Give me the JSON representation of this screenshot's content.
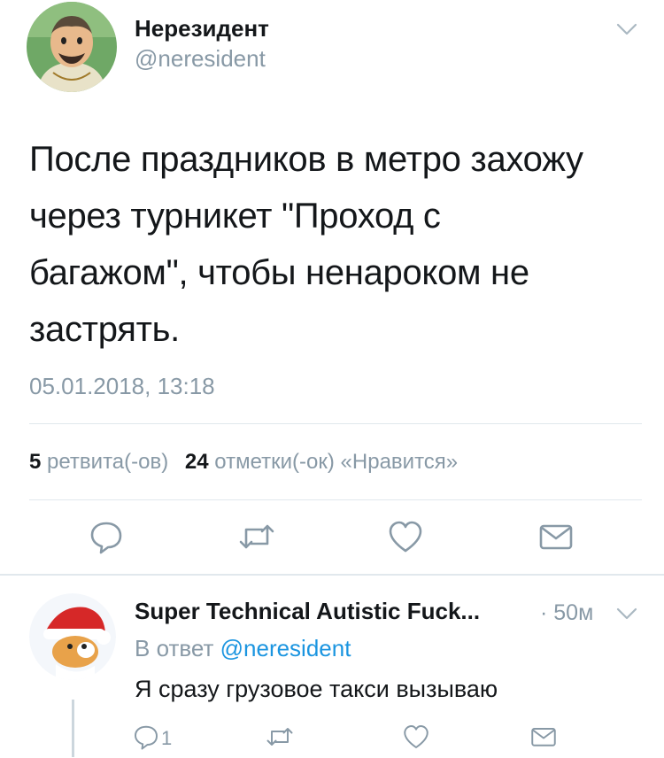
{
  "tweet": {
    "author_name": "Нерезидент",
    "handle": "@neresident",
    "text_lines": [
      "После праздников в метро захожу",
      "через турникет \"Проход с",
      "багажом\", чтобы ненароком не",
      "застрять."
    ],
    "timestamp": "05.01.2018, 13:18",
    "stats": {
      "retweets_count": "5",
      "retweets_label": "ретвита(-ов)",
      "likes_count": "24",
      "likes_label": "отметки(-ок) «Нравится»"
    }
  },
  "reply": {
    "author_name": "Super Technical Autistic Fuck...",
    "time": "· 50м",
    "in_reply_prefix": "В ответ",
    "in_reply_handle": "@neresident",
    "text": "Я сразу грузовое такси вызываю",
    "reply_count": "1"
  },
  "icons": [
    "chevron-down",
    "reply",
    "retweet",
    "like",
    "direct-message"
  ],
  "colors": {
    "accent": "#1b95e0",
    "muted": "#8899a6",
    "divider": "#e1e8ed",
    "text": "#14171a"
  }
}
